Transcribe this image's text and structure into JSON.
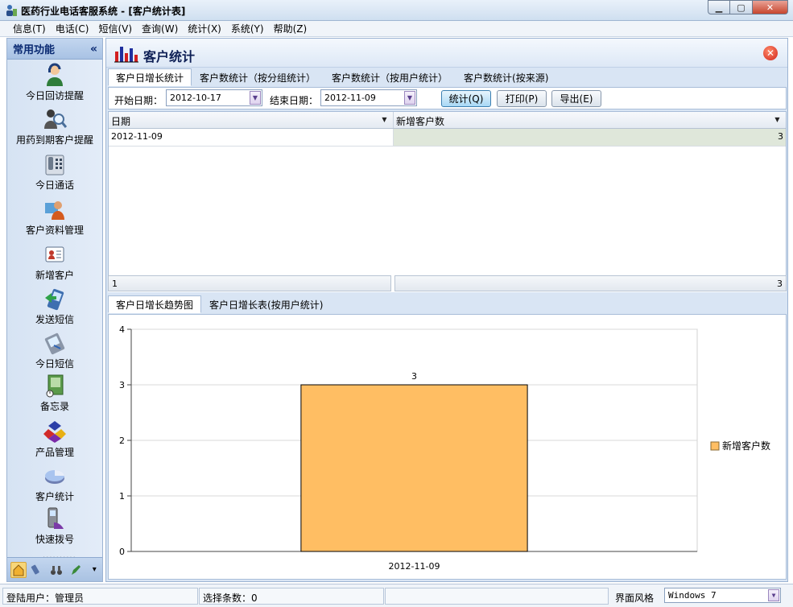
{
  "window": {
    "title": "医药行业电话客服系统 - [客户统计表]",
    "min_glyph": "▁",
    "max_glyph": "▢",
    "close_glyph": "✕"
  },
  "menu": [
    "信息(T)",
    "电话(C)",
    "短信(V)",
    "查询(W)",
    "统计(X)",
    "系统(Y)",
    "帮助(Z)"
  ],
  "sidebar": {
    "header": "常用功能",
    "collapse_glyph": "«",
    "items": [
      {
        "label": "今日回访提醒",
        "icon": "person-headset-icon"
      },
      {
        "label": "用药到期客户提醒",
        "icon": "magnifier-person-icon"
      },
      {
        "label": "今日通话",
        "icon": "telephone-icon"
      },
      {
        "label": "客户资料管理",
        "icon": "person-card-icon"
      },
      {
        "label": "新增客户",
        "icon": "id-card-icon"
      },
      {
        "label": "发送短信",
        "icon": "send-sms-icon"
      },
      {
        "label": "今日短信",
        "icon": "sms-device-icon"
      },
      {
        "label": "备忘录",
        "icon": "memo-clock-icon"
      },
      {
        "label": "产品管理",
        "icon": "cubes-icon"
      },
      {
        "label": "客户统计",
        "icon": "pie-chart-icon"
      },
      {
        "label": "快速拨号",
        "icon": "mobile-phone-icon"
      }
    ],
    "more_dots": "..........",
    "footer_tools": [
      "home-icon",
      "phone-icon",
      "binoculars-icon",
      "pen-icon"
    ],
    "footer_more": "▾"
  },
  "panel": {
    "title": "客户统计",
    "close_glyph": "✕",
    "tabs": [
      "客户日增长统计",
      "客户数统计（按分组统计）",
      "客户数统计（按用户统计）",
      "客户数统计(按来源)"
    ],
    "active_tab": 0,
    "filters": {
      "start_label": "开始日期：",
      "start_value": "2012-10-17",
      "end_label": "结束日期：",
      "end_value": "2012-11-09",
      "dd_glyph": "▼"
    },
    "buttons": {
      "stat": "统计(Q)",
      "print": "打印(P)",
      "export": "导出(E)"
    },
    "grid": {
      "columns": [
        "日期",
        "新增客户数"
      ],
      "rows": [
        [
          "2012-11-09",
          "3"
        ]
      ],
      "footer": [
        "1",
        "3"
      ],
      "dd_glyph": "▼"
    },
    "sub_tabs": [
      "客户日增长趋势图",
      "客户日增长表(按用户统计)"
    ],
    "active_sub_tab": 0
  },
  "chart_data": {
    "type": "bar",
    "categories": [
      "2012-11-09"
    ],
    "series": [
      {
        "name": "新增客户数",
        "values": [
          3
        ],
        "color": "#ffbe63"
      }
    ],
    "data_labels": [
      "3"
    ],
    "ylim": [
      0,
      4
    ],
    "yticks": [
      "0",
      "1",
      "2",
      "3",
      "4"
    ],
    "grid": true,
    "legend_position": "right",
    "title": "",
    "xlabel": "",
    "ylabel": ""
  },
  "status": {
    "user": "登陆用户：管理员",
    "selected": "选择条数：0",
    "style_label": "界面风格",
    "style_value": "Windows 7",
    "dd_glyph": "▼"
  }
}
